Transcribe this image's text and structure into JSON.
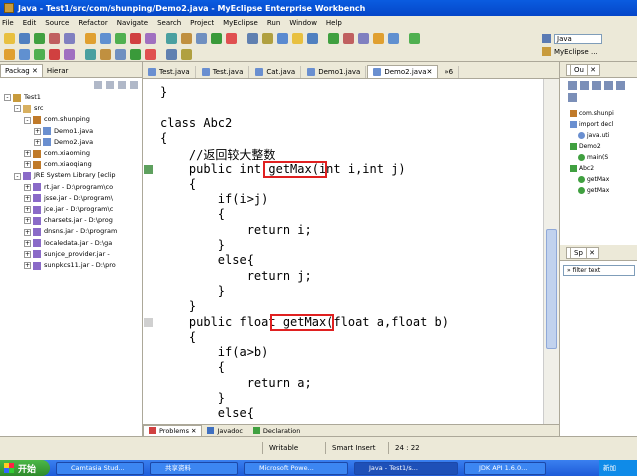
{
  "window": {
    "title": "Java - Test1/src/com/shunping/Demo2.java - MyEclipse Enterprise Workbench"
  },
  "menu": [
    "File",
    "Edit",
    "Source",
    "Refactor",
    "Navigate",
    "Search",
    "Project",
    "MyEclipse",
    "Run",
    "Window",
    "Help"
  ],
  "perspective": {
    "current": "Java",
    "other": "MyEclipse ..."
  },
  "left": {
    "tabs": [
      "Packag",
      "Hierar"
    ],
    "tree": [
      {
        "label": "Test1",
        "indent": 0,
        "twisty": "-"
      },
      {
        "label": "src",
        "indent": 1,
        "twisty": "-"
      },
      {
        "label": "com.shunping",
        "indent": 2,
        "twisty": "-"
      },
      {
        "label": "Demo1.java",
        "indent": 3,
        "twisty": "+"
      },
      {
        "label": "Demo2.java",
        "indent": 3,
        "twisty": "+"
      },
      {
        "label": "com.xiaoming",
        "indent": 2,
        "twisty": "+"
      },
      {
        "label": "com.xiaoqiang",
        "indent": 2,
        "twisty": "+"
      },
      {
        "label": "JRE System Library [eclip",
        "indent": 1,
        "twisty": "-"
      },
      {
        "label": "rt.jar - D:\\program\\co",
        "indent": 2,
        "twisty": "+"
      },
      {
        "label": "jsse.jar - D:\\program\\",
        "indent": 2,
        "twisty": "+"
      },
      {
        "label": "jce.jar - D:\\program\\c",
        "indent": 2,
        "twisty": "+"
      },
      {
        "label": "charsets.jar - D:\\prog",
        "indent": 2,
        "twisty": "+"
      },
      {
        "label": "dnsns.jar - D:\\program",
        "indent": 2,
        "twisty": "+"
      },
      {
        "label": "localedata.jar - D:\\ga",
        "indent": 2,
        "twisty": "+"
      },
      {
        "label": "sunjce_provider.jar - ",
        "indent": 2,
        "twisty": "+"
      },
      {
        "label": "sunpkcs11.jar - D:\\pro",
        "indent": 2,
        "twisty": "+"
      }
    ]
  },
  "editor": {
    "tabs": [
      "Test.java",
      "Test.java",
      "Cat.java",
      "Demo1.java",
      "Demo2.java"
    ],
    "overflow": "»6",
    "lines": [
      "}",
      "",
      "class Abc2",
      "{",
      "    //返回较大整数",
      "    public int getMax(int i,int j)",
      "    {",
      "        if(i>j)",
      "        {",
      "            return i;",
      "        }",
      "        else{",
      "            return j;",
      "        }",
      "    }",
      "    public float getMax(float a,float b)",
      "    {",
      "        if(a>b)",
      "        {",
      "            return a;",
      "        }",
      "        else{"
    ]
  },
  "right": {
    "outline_tab": "Ou",
    "outline": [
      {
        "label": "com.shunpi",
        "indent": 0
      },
      {
        "label": "import decl",
        "indent": 0
      },
      {
        "label": "java.uti",
        "indent": 1
      },
      {
        "label": "Demo2",
        "indent": 0
      },
      {
        "label": "main(S",
        "indent": 1
      },
      {
        "label": "Abc2",
        "indent": 0
      },
      {
        "label": "getMax",
        "indent": 1
      },
      {
        "label": "getMax",
        "indent": 1
      }
    ],
    "sp_tab": "Sp",
    "filter": "» filter text"
  },
  "bottom": {
    "tabs": [
      "Problems",
      "Javadoc",
      "Declaration"
    ]
  },
  "status": {
    "writable": "Writable",
    "insert": "Smart Insert",
    "position": "24 : 22"
  },
  "taskbar": {
    "start": "开始",
    "tasks": [
      "Camtasia Stud...",
      "共享资料",
      "Microsoft Powe...",
      "Java - Test1/s...",
      "JDK API 1.6.0..."
    ],
    "tray": "新加"
  }
}
